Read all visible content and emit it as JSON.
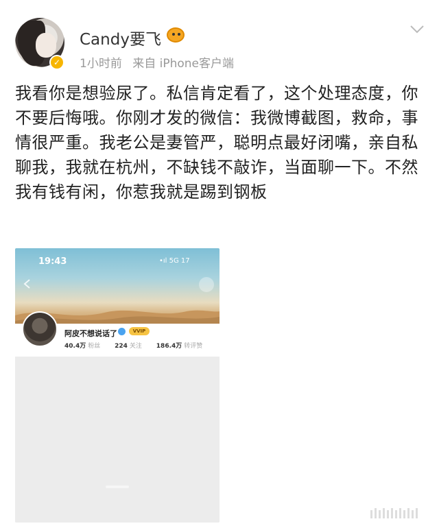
{
  "header": {
    "username": "Candy要飞",
    "time": "1小时前",
    "source": "来自 iPhone客户端"
  },
  "post": {
    "text": "我看你是想验尿了。私信肯定看了，这个处理态度，你不要后悔哦。你刚才发的微信：我微博截图，救命，事情很严重。我老公是妻管严，聪明点最好闭嘴，亲自私聊我，我就在杭州，不缺钱不敲诈，当面聊一下。不然我有钱有闲，你惹我就是踢到钢板"
  },
  "screenshot": {
    "status_time": "19:43",
    "status_right": "•ıl 5G 17",
    "profile_name": "阿皮不想说话了",
    "vip_label": "VVIP",
    "stats": [
      {
        "num": "40.4万",
        "label": "粉丝"
      },
      {
        "num": "224",
        "label": "关注"
      },
      {
        "num": "186.4万",
        "label": "转评赞"
      }
    ]
  },
  "colors": {
    "meta_gray": "#999999",
    "verify_gold": "#f7b500",
    "text_dark": "#222222"
  }
}
